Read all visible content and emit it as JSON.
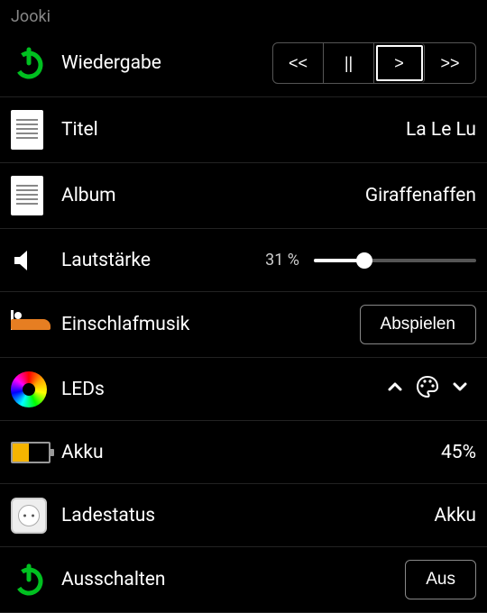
{
  "header": {
    "title": "Jooki"
  },
  "playback": {
    "label": "Wiedergabe",
    "buttons": {
      "prev": "<<",
      "pause": "||",
      "play": ">",
      "next": ">>"
    },
    "active": "play"
  },
  "title_row": {
    "label": "Titel",
    "value": "La Le Lu"
  },
  "album_row": {
    "label": "Album",
    "value": "Giraffenaffen"
  },
  "volume": {
    "label": "Lautstärke",
    "percent": 31,
    "display": "31 %"
  },
  "sleep": {
    "label": "Einschlafmusik",
    "button": "Abspielen"
  },
  "leds": {
    "label": "LEDs"
  },
  "battery": {
    "label": "Akku",
    "percent": 45,
    "display": "45%"
  },
  "charge": {
    "label": "Ladestatus",
    "value": "Akku"
  },
  "power": {
    "label": "Ausschalten",
    "button": "Aus"
  },
  "colors": {
    "accent_green": "#00c020",
    "accent_orange": "#f5b400"
  }
}
